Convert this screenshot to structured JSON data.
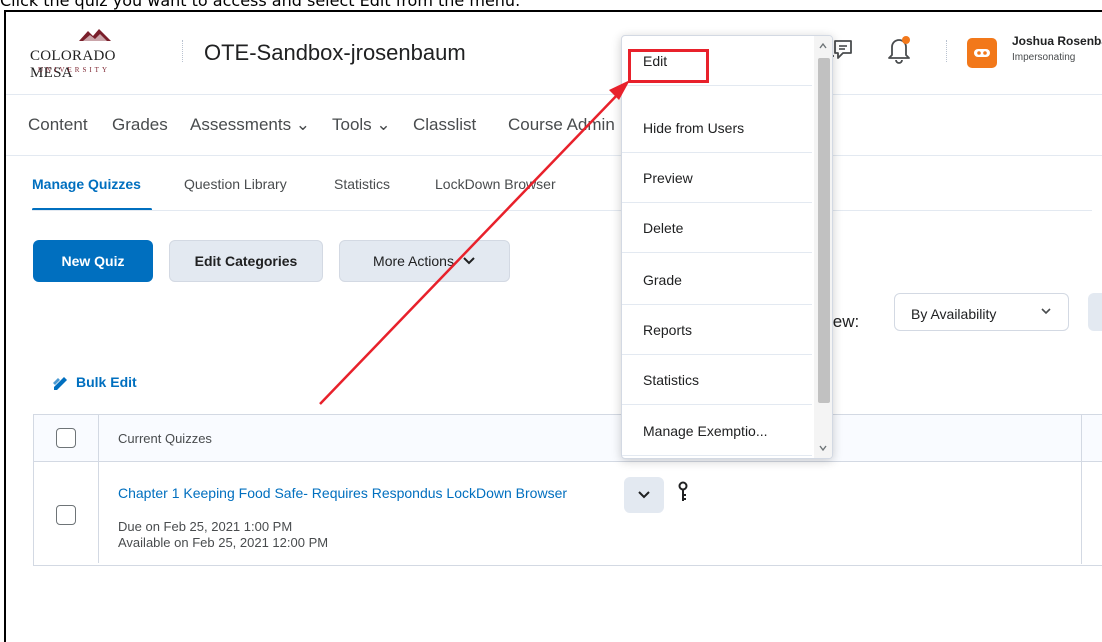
{
  "caption": "Click the quiz you want to access and select Edit from the menu.",
  "header": {
    "logo_text": "COLORADO MESA",
    "logo_sub": "UNIVERSITY",
    "course_title": "OTE-Sandbox-jrosenbaum",
    "user_name": "Joshua Rosenbaum",
    "user_status": "Impersonating"
  },
  "nav": {
    "items": [
      "Content",
      "Grades",
      "Assessments ⌄",
      "Tools ⌄",
      "Classlist",
      "Course Admin"
    ]
  },
  "subtabs": {
    "items": [
      "Manage Quizzes",
      "Question Library",
      "Statistics",
      "LockDown Browser"
    ]
  },
  "toolbar": {
    "new_quiz": "New Quiz",
    "edit_categories": "Edit Categories",
    "more_actions": "More Actions"
  },
  "view": {
    "label": "View:",
    "selected": "By Availability"
  },
  "bulk_edit": "Bulk Edit",
  "table": {
    "header": "Current Quizzes",
    "rows": [
      {
        "title": "Chapter 1 Keeping Food Safe- Requires Respondus LockDown Browser",
        "due": "Due on Feb 25, 2021 1:00 PM",
        "available": "Available on Feb 25, 2021 12:00 PM"
      }
    ]
  },
  "context_menu": {
    "items": [
      "Edit",
      "Hide from Users",
      "Preview",
      "Delete",
      "Grade",
      "Reports",
      "Statistics",
      "Manage Exemptio..."
    ]
  },
  "colors": {
    "accent": "#006fbf",
    "annotation": "#e8212b",
    "avatar": "#f2781a"
  }
}
